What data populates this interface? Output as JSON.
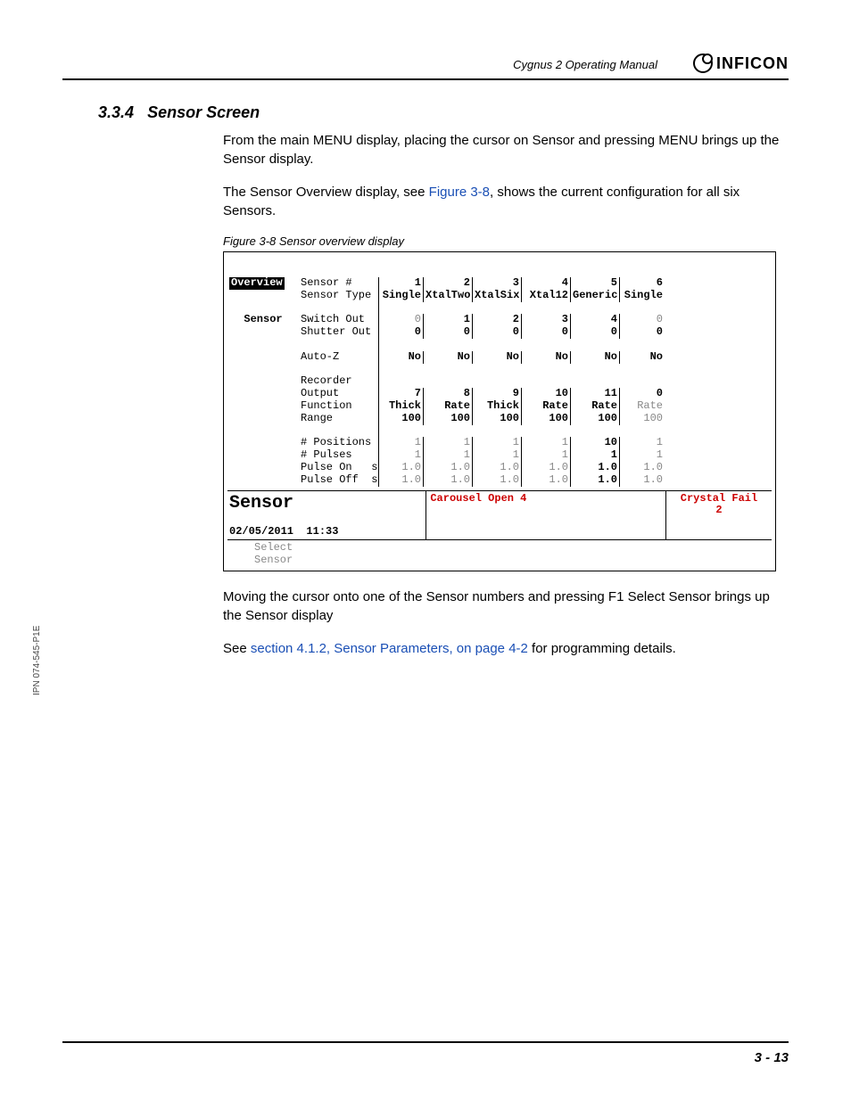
{
  "header": {
    "doc_title": "Cygnus 2 Operating Manual",
    "brand": "INFICON"
  },
  "section": {
    "number": "3.3.4",
    "title": "Sensor Screen"
  },
  "paragraphs": {
    "p1": "From the main MENU display, placing the cursor on Sensor and pressing MENU brings up the Sensor display.",
    "p2a": "The Sensor Overview display, see ",
    "p2_link": "Figure 3-8",
    "p2b": ", shows the current configuration for all six Sensors.",
    "p3": "Moving the cursor onto one of the Sensor numbers and pressing F1 Select Sensor brings up the Sensor display",
    "p4a": "See ",
    "p4_link": "section 4.1.2, Sensor Parameters, on page 4-2",
    "p4b": " for programming details."
  },
  "figure": {
    "caption": "Figure 3-8  Sensor overview display",
    "tabs": {
      "overview": "Overview",
      "sensor": "Sensor"
    },
    "labels": {
      "sensor_num": "Sensor #",
      "sensor_type": "Sensor Type",
      "switch_out": "Switch Out",
      "shutter_out": "Shutter Out",
      "auto_z": "Auto-Z",
      "recorder": "Recorder",
      "output": "Output",
      "function": "Function",
      "range": "Range",
      "positions": "# Positions",
      "pulses": "# Pulses",
      "pulse_on": "Pulse On",
      "pulse_off": "Pulse Off",
      "unit_s": "s"
    },
    "cols": {
      "num": [
        "1",
        "2",
        "3",
        "4",
        "5",
        "6"
      ],
      "type": [
        "Single",
        "XtalTwo",
        "XtalSix",
        "Xtal12",
        "Generic",
        "Single"
      ],
      "switch_out": [
        "0",
        "1",
        "2",
        "3",
        "4",
        "0"
      ],
      "shutter_out": [
        "0",
        "0",
        "0",
        "0",
        "0",
        "0"
      ],
      "auto_z": [
        "No",
        "No",
        "No",
        "No",
        "No",
        "No"
      ],
      "output": [
        "7",
        "8",
        "9",
        "10",
        "11",
        "0"
      ],
      "function": [
        "Thick",
        "Rate",
        "Thick",
        "Rate",
        "Rate",
        "Rate"
      ],
      "range": [
        "100",
        "100",
        "100",
        "100",
        "100",
        "100"
      ],
      "positions": [
        "1",
        "1",
        "1",
        "1",
        "10",
        "1"
      ],
      "pulses": [
        "1",
        "1",
        "1",
        "1",
        "1",
        "1"
      ],
      "pulse_on": [
        "1.0",
        "1.0",
        "1.0",
        "1.0",
        "1.0",
        "1.0"
      ],
      "pulse_off": [
        "1.0",
        "1.0",
        "1.0",
        "1.0",
        "1.0",
        "1.0"
      ]
    },
    "status": {
      "screen_name": "Sensor",
      "carousel": "Carousel Open 4",
      "crystal_fail": "Crystal Fail",
      "crystal_fail_num": "2",
      "date": "02/05/2011",
      "time": "11:33",
      "select_l1": "Select",
      "select_l2": "Sensor"
    }
  },
  "side_label": "IPN 074-545-P1E",
  "page_number": "3 - 13"
}
